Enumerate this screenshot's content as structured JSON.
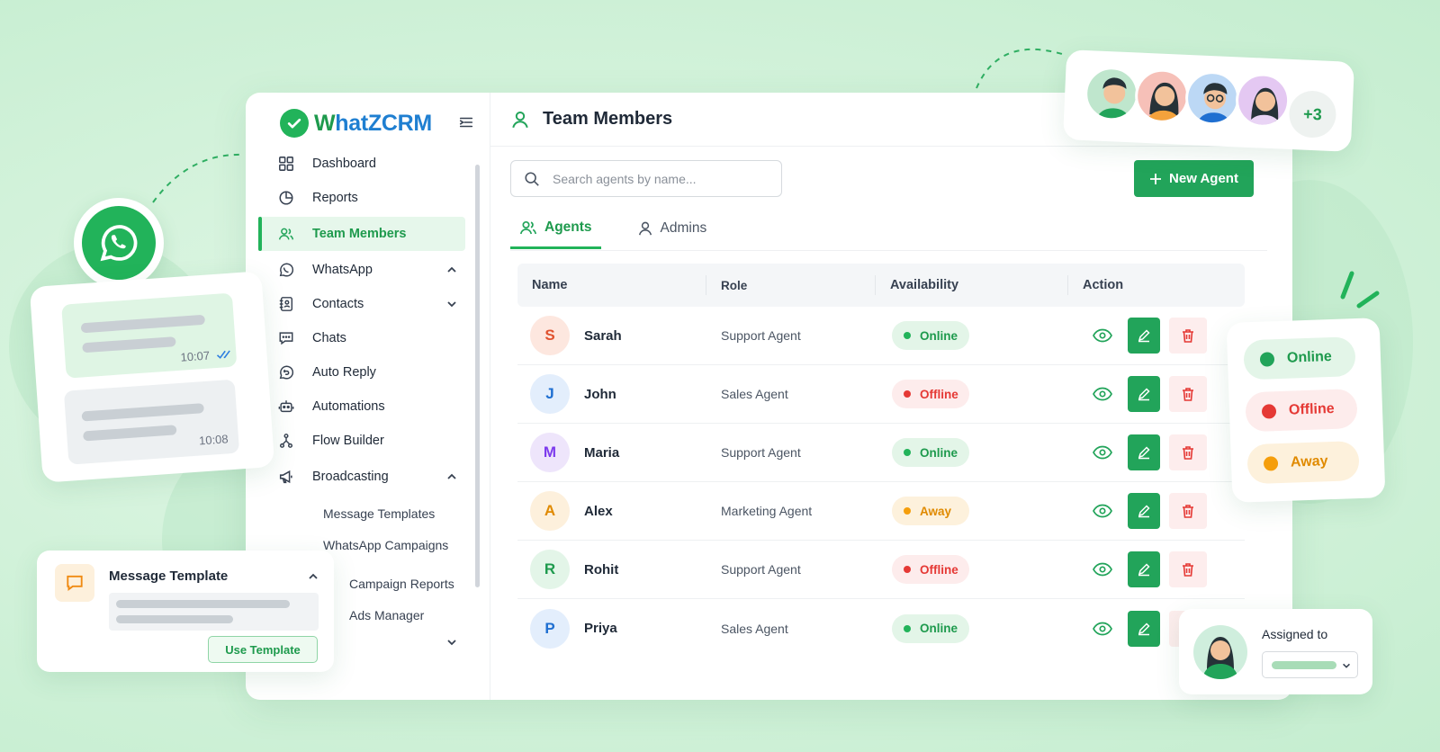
{
  "app": {
    "brand_prefix": "W",
    "brand_rest": "hatZCRM",
    "page_title": "Team Members"
  },
  "sidebar": {
    "items": [
      {
        "label": "Dashboard",
        "icon": "dashboard-icon"
      },
      {
        "label": "Reports",
        "icon": "pie-chart-icon"
      },
      {
        "label": "Team Members",
        "icon": "users-icon",
        "active": true
      },
      {
        "label": "WhatsApp",
        "icon": "whatsapp-icon",
        "expanded": true
      },
      {
        "label": "Contacts",
        "icon": "contacts-icon"
      },
      {
        "label": "Chats",
        "icon": "chat-icon"
      },
      {
        "label": "Auto Reply",
        "icon": "auto-reply-icon"
      },
      {
        "label": "Automations",
        "icon": "robot-icon"
      },
      {
        "label": "Flow Builder",
        "icon": "flow-icon"
      },
      {
        "label": "Broadcasting",
        "icon": "megaphone-icon",
        "expanded": true
      }
    ],
    "sub_items": [
      "Message Templates",
      "WhatsApp Campaigns",
      "Campaign Reports",
      "Ads Manager"
    ]
  },
  "toolbar": {
    "search_placeholder": "Search agents by name...",
    "new_agent_label": "New Agent"
  },
  "tabs": [
    "Agents",
    "Admins"
  ],
  "table": {
    "headers": [
      "Name",
      "Role",
      "Availability",
      "Action"
    ],
    "rows": [
      {
        "initial": "S",
        "name": "Sarah",
        "role": "Support Agent",
        "status": "Online",
        "avatar_bg": "#fde7df",
        "avatar_fg": "#e0522f"
      },
      {
        "initial": "J",
        "name": "John",
        "role": "Sales Agent",
        "status": "Offline",
        "avatar_bg": "#e3eefc",
        "avatar_fg": "#1f6fd1"
      },
      {
        "initial": "M",
        "name": "Maria",
        "role": "Support Agent",
        "status": "Online",
        "avatar_bg": "#eee5fb",
        "avatar_fg": "#7c3aed"
      },
      {
        "initial": "A",
        "name": "Alex",
        "role": "Marketing Agent",
        "status": "Away",
        "avatar_bg": "#fdf0dc",
        "avatar_fg": "#e08a00"
      },
      {
        "initial": "R",
        "name": "Rohit",
        "role": "Support Agent",
        "status": "Offline",
        "avatar_bg": "#e3f5e8",
        "avatar_fg": "#1e9a4d"
      },
      {
        "initial": "P",
        "name": "Priya",
        "role": "Sales Agent",
        "status": "Online",
        "avatar_bg": "#e3eefc",
        "avatar_fg": "#1f6fd1"
      }
    ]
  },
  "chat_preview": {
    "time_sent": "10:07",
    "time_received": "10:08"
  },
  "template_card": {
    "title": "Message Template",
    "button": "Use Template"
  },
  "team_card": {
    "more_count": "+3"
  },
  "status_legend": [
    "Online",
    "Offline",
    "Away"
  ],
  "assign_card": {
    "title": "Assigned to"
  },
  "colors": {
    "brand_green": "#22b35a",
    "brand_blue": "#1f7fd1",
    "online": "#22b35a",
    "offline": "#e53935",
    "away": "#f59e0b"
  }
}
